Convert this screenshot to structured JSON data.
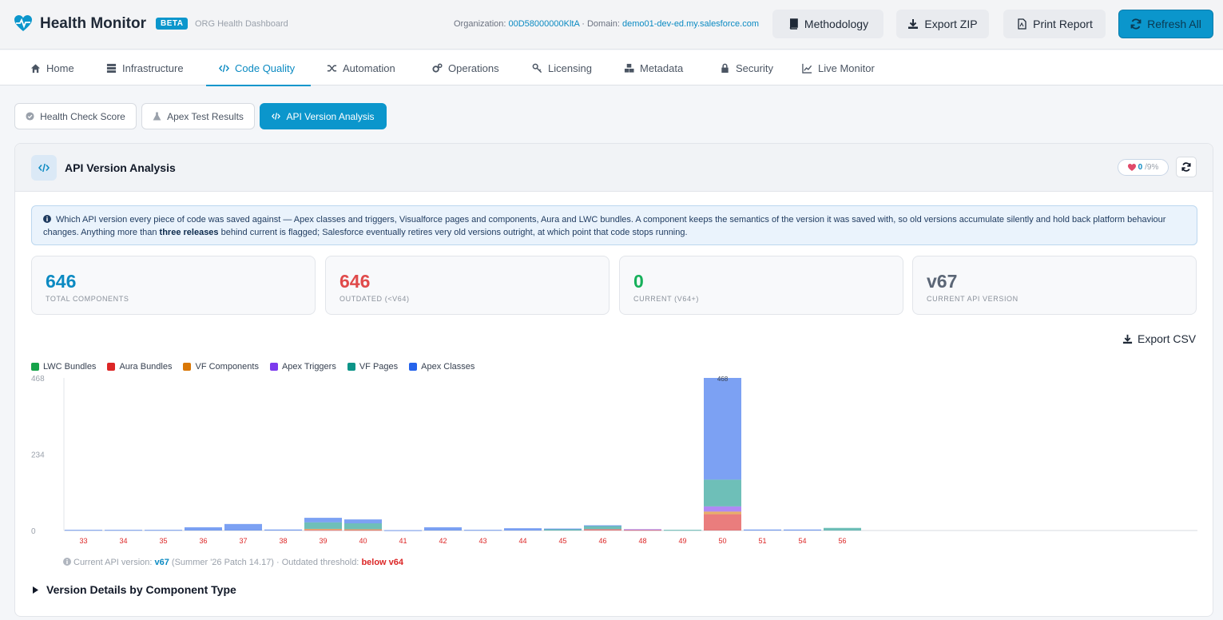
{
  "header": {
    "app_title": "Health Monitor",
    "beta": "BETA",
    "subtitle": "ORG Health Dashboard",
    "org_label": "Organization:",
    "org_id": "00D58000000KltA",
    "domain_label": "· Domain:",
    "domain": "demo01-dev-ed.my.salesforce.com",
    "buttons": {
      "methodology": "Methodology",
      "export_zip": "Export ZIP",
      "print_report": "Print Report",
      "refresh_all": "Refresh All"
    }
  },
  "nav": {
    "home": "Home",
    "infrastructure": "Infrastructure",
    "code_quality": "Code Quality",
    "automation": "Automation",
    "operations": "Operations",
    "licensing": "Licensing",
    "metadata": "Metadata",
    "security": "Security",
    "live_monitor": "Live Monitor",
    "active": "Code Quality"
  },
  "subtabs": {
    "health_check": "Health Check Score",
    "apex_tests": "Apex Test Results",
    "api_version": "API Version Analysis",
    "active": "API Version Analysis"
  },
  "panel": {
    "title": "API Version Analysis",
    "score_value": "0",
    "score_max": "/9%",
    "info_part1": "Which API version every piece of code was saved against — Apex classes and triggers, Visualforce pages and components, Aura and LWC bundles. A component keeps the semantics of the version it was saved with, so old versions accumulate silently and hold back platform behaviour changes. Anything more than",
    "info_bold": "three releases",
    "info_part2": "behind current is flagged; Salesforce eventually retires very old versions outright, at which point that code stops running.",
    "stats": [
      {
        "value": "646",
        "label": "TOTAL COMPONENTS",
        "color": "#0b8ac2"
      },
      {
        "value": "646",
        "label": "OUTDATED (<V64)",
        "color": "#e04a4a"
      },
      {
        "value": "0",
        "label": "CURRENT (V64+)",
        "color": "#16b05a"
      },
      {
        "value": "v67",
        "label": "CURRENT API VERSION",
        "color": "#5b6676"
      }
    ],
    "export_csv": "Export CSV",
    "footnote_prefix": "Current API version:",
    "footnote_version": "v67",
    "footnote_mid": "(Summer '26 Patch 14.17) · Outdated threshold:",
    "footnote_threshold": "below v64",
    "details_label": "Version Details by Component Type"
  },
  "chart_data": {
    "type": "bar",
    "stacked": true,
    "categories": [
      "33",
      "34",
      "35",
      "36",
      "37",
      "38",
      "39",
      "40",
      "41",
      "42",
      "43",
      "44",
      "45",
      "46",
      "48",
      "49",
      "50",
      "51",
      "54",
      "56"
    ],
    "y_ticks": [
      "468",
      "234",
      "0"
    ],
    "ylim": [
      0,
      468
    ],
    "top_label": {
      "category": "50",
      "text": "468"
    },
    "series": [
      {
        "name": "LWC Bundles",
        "color": "#16a34a",
        "values": [
          0,
          0,
          0,
          0,
          0,
          0,
          0,
          0,
          0,
          0,
          0,
          0,
          0,
          0,
          0,
          0,
          0,
          0,
          0,
          0
        ]
      },
      {
        "name": "Aura Bundles",
        "color": "#dc2626",
        "values": [
          0,
          0,
          0,
          0,
          0,
          0,
          2,
          2,
          0,
          0,
          0,
          0,
          0,
          4,
          2,
          0,
          50,
          0,
          0,
          0
        ]
      },
      {
        "name": "VF Components",
        "color": "#d97706",
        "values": [
          0,
          0,
          0,
          0,
          0,
          0,
          3,
          2,
          0,
          0,
          0,
          0,
          0,
          0,
          0,
          0,
          8,
          0,
          0,
          0
        ]
      },
      {
        "name": "Apex Triggers",
        "color": "#7c3aed",
        "values": [
          0,
          0,
          0,
          0,
          0,
          0,
          0,
          0,
          0,
          0,
          0,
          0,
          0,
          0,
          2,
          0,
          16,
          0,
          0,
          0
        ]
      },
      {
        "name": "VF Pages",
        "color": "#0d9488",
        "values": [
          0,
          0,
          0,
          0,
          0,
          0,
          20,
          18,
          0,
          0,
          0,
          0,
          4,
          10,
          0,
          2,
          82,
          0,
          0,
          8
        ]
      },
      {
        "name": "Apex Classes",
        "color": "#2563eb",
        "values": [
          2,
          2,
          2,
          10,
          20,
          3,
          14,
          12,
          1,
          10,
          2,
          7,
          2,
          2,
          0,
          0,
          312,
          3,
          3,
          0
        ]
      }
    ]
  }
}
